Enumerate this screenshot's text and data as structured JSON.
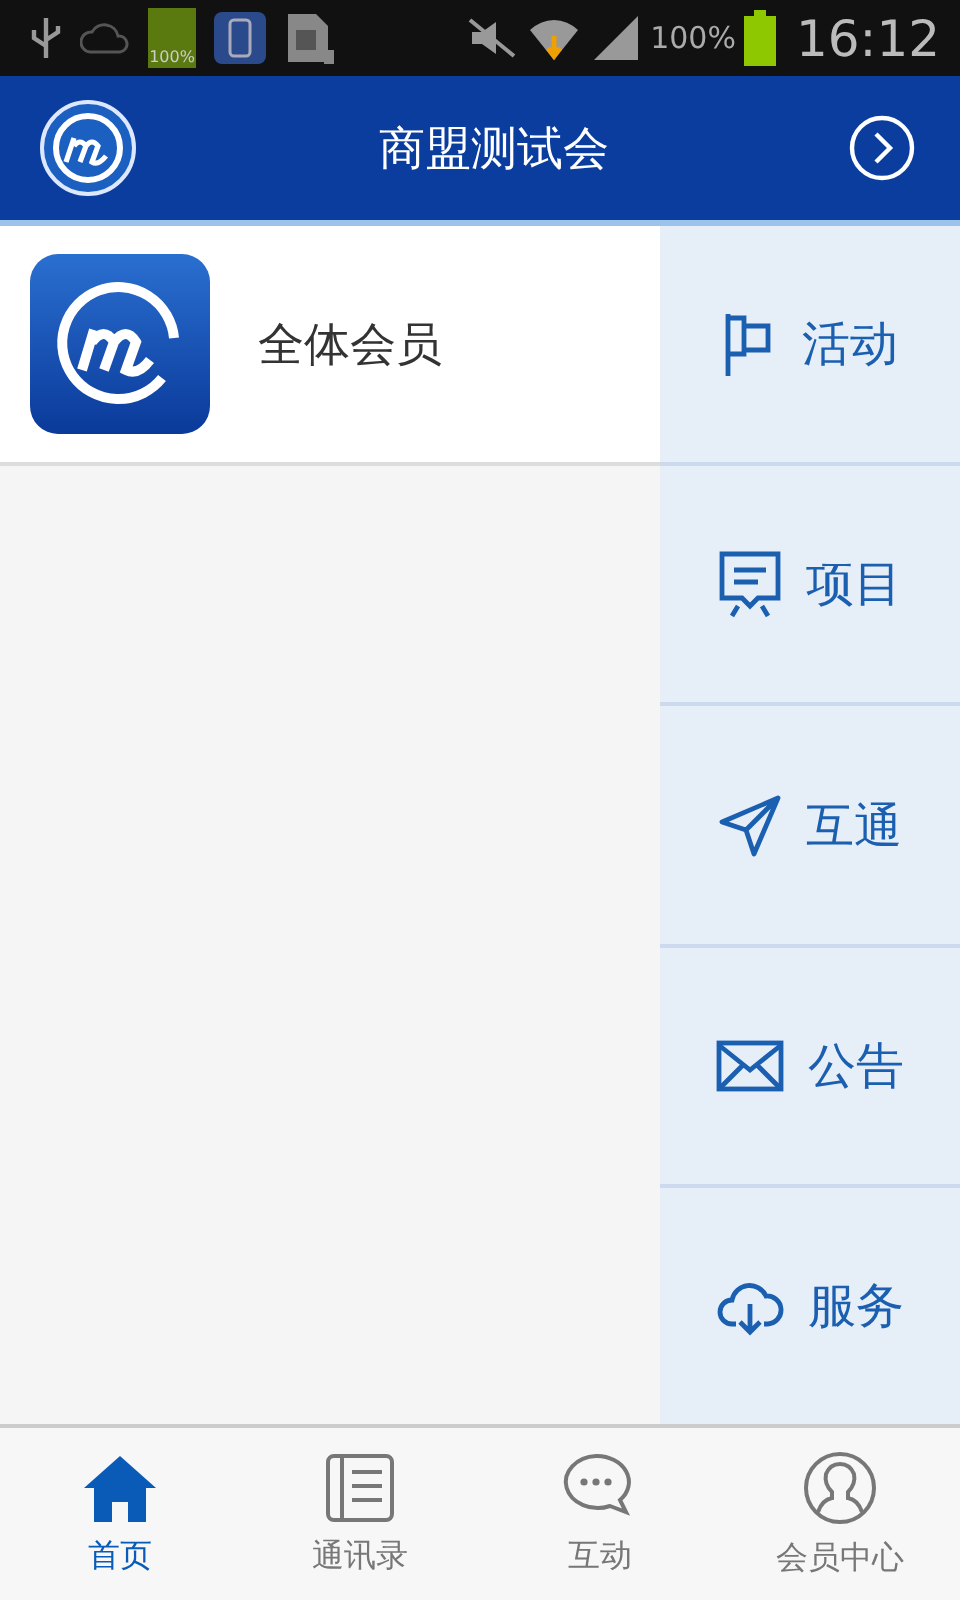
{
  "status_bar": {
    "battery_text": "100%",
    "time": "16:12",
    "small_battery_text": "100%"
  },
  "header": {
    "title": "商盟测试会"
  },
  "list": [
    {
      "label": "全体会员"
    }
  ],
  "side_menu": [
    {
      "label": "活动"
    },
    {
      "label": "项目"
    },
    {
      "label": "互通"
    },
    {
      "label": "公告"
    },
    {
      "label": "服务"
    }
  ],
  "tabs": [
    {
      "label": "首页",
      "selected": true
    },
    {
      "label": "通讯录",
      "selected": false
    },
    {
      "label": "互动",
      "selected": false
    },
    {
      "label": "会员中心",
      "selected": false
    }
  ]
}
